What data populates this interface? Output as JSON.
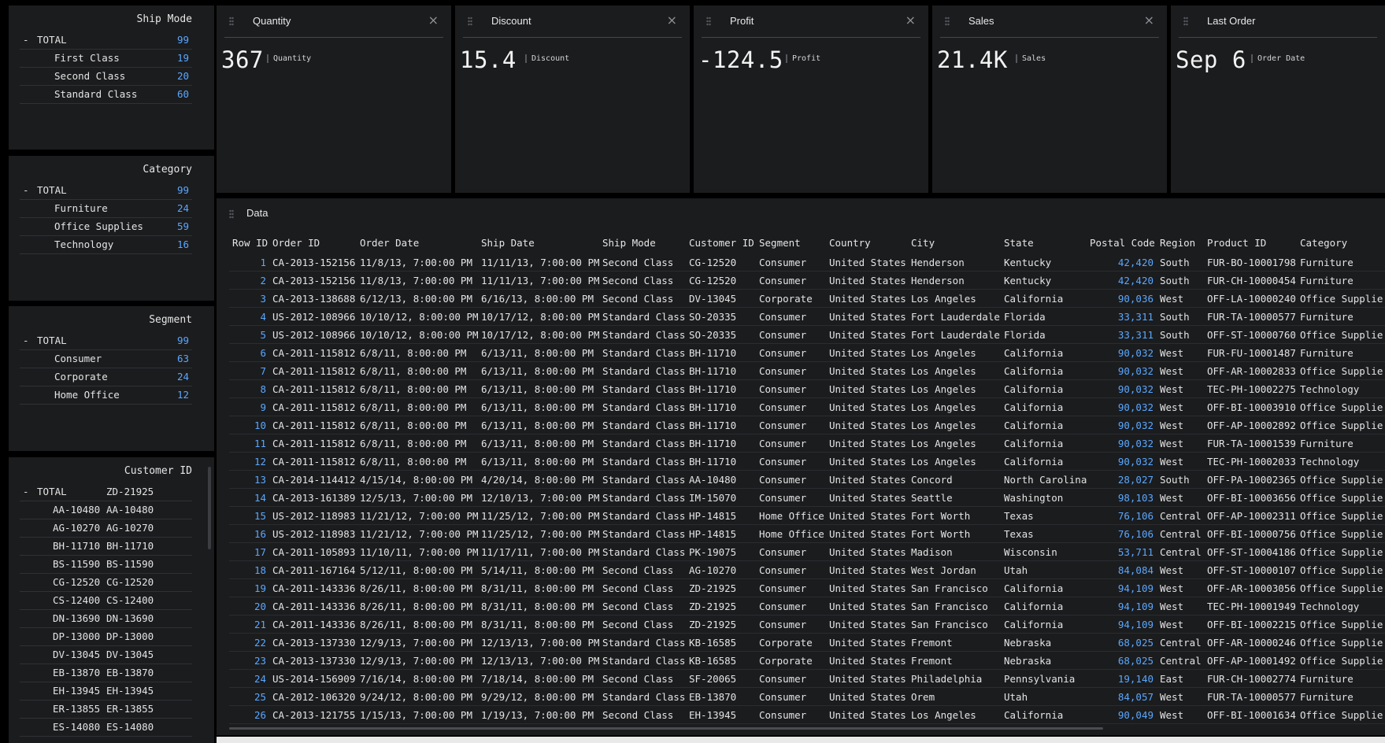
{
  "filters": {
    "ship_mode": {
      "title": "Ship Mode",
      "total": {
        "label": "TOTAL",
        "count": "99"
      },
      "items": [
        {
          "label": "First Class",
          "count": "19"
        },
        {
          "label": "Second Class",
          "count": "20"
        },
        {
          "label": "Standard Class",
          "count": "60"
        }
      ]
    },
    "category": {
      "title": "Category",
      "total": {
        "label": "TOTAL",
        "count": "99"
      },
      "items": [
        {
          "label": "Furniture",
          "count": "24"
        },
        {
          "label": "Office Supplies",
          "count": "59"
        },
        {
          "label": "Technology",
          "count": "16"
        }
      ]
    },
    "segment": {
      "title": "Segment",
      "total": {
        "label": "TOTAL",
        "count": "99"
      },
      "items": [
        {
          "label": "Consumer",
          "count": "63"
        },
        {
          "label": "Corporate",
          "count": "24"
        },
        {
          "label": "Home Office",
          "count": "12"
        }
      ]
    },
    "customer_id": {
      "title": "Customer ID",
      "total": {
        "label": "TOTAL",
        "value": "ZD-21925"
      },
      "items": [
        {
          "label": "AA-10480",
          "value": "AA-10480"
        },
        {
          "label": "AG-10270",
          "value": "AG-10270"
        },
        {
          "label": "BH-11710",
          "value": "BH-11710"
        },
        {
          "label": "BS-11590",
          "value": "BS-11590"
        },
        {
          "label": "CG-12520",
          "value": "CG-12520"
        },
        {
          "label": "CS-12400",
          "value": "CS-12400"
        },
        {
          "label": "DN-13690",
          "value": "DN-13690"
        },
        {
          "label": "DP-13000",
          "value": "DP-13000"
        },
        {
          "label": "DV-13045",
          "value": "DV-13045"
        },
        {
          "label": "EB-13870",
          "value": "EB-13870"
        },
        {
          "label": "EH-13945",
          "value": "EH-13945"
        },
        {
          "label": "ER-13855",
          "value": "ER-13855"
        },
        {
          "label": "ES-14080",
          "value": "ES-14080"
        }
      ]
    },
    "toggle_symbol": "-"
  },
  "kpis": [
    {
      "title": "Quantity",
      "value": "367",
      "unit": "Quantity"
    },
    {
      "title": "Discount",
      "value": "15.4",
      "unit": "Discount"
    },
    {
      "title": "Profit",
      "value": "-124.5",
      "unit": "Profit"
    },
    {
      "title": "Sales",
      "value": "21.4K",
      "unit": "Sales"
    },
    {
      "title": "Last Order",
      "value": "Sep 6",
      "unit": "Order Date"
    }
  ],
  "close_symbol": "×",
  "data_panel": {
    "title": "Data",
    "columns": [
      "Row ID",
      "Order ID",
      "Order Date",
      "Ship Date",
      "Ship Mode",
      "Customer ID",
      "Segment",
      "Country",
      "City",
      "State",
      "Postal Code",
      "Region",
      "Product ID",
      "Category"
    ],
    "rows": [
      [
        "1",
        "CA-2013-152156",
        "11/8/13, 7:00:00 PM",
        "11/11/13, 7:00:00 PM",
        "Second Class",
        "CG-12520",
        "Consumer",
        "United States",
        "Henderson",
        "Kentucky",
        "42,420",
        "South",
        "FUR-BO-10001798",
        "Furniture"
      ],
      [
        "2",
        "CA-2013-152156",
        "11/8/13, 7:00:00 PM",
        "11/11/13, 7:00:00 PM",
        "Second Class",
        "CG-12520",
        "Consumer",
        "United States",
        "Henderson",
        "Kentucky",
        "42,420",
        "South",
        "FUR-CH-10000454",
        "Furniture"
      ],
      [
        "3",
        "CA-2013-138688",
        "6/12/13, 8:00:00 PM",
        "6/16/13, 8:00:00 PM",
        "Second Class",
        "DV-13045",
        "Corporate",
        "United States",
        "Los Angeles",
        "California",
        "90,036",
        "West",
        "OFF-LA-10000240",
        "Office Supplie"
      ],
      [
        "4",
        "US-2012-108966",
        "10/10/12, 8:00:00 PM",
        "10/17/12, 8:00:00 PM",
        "Standard Class",
        "SO-20335",
        "Consumer",
        "United States",
        "Fort Lauderdale",
        "Florida",
        "33,311",
        "South",
        "FUR-TA-10000577",
        "Furniture"
      ],
      [
        "5",
        "US-2012-108966",
        "10/10/12, 8:00:00 PM",
        "10/17/12, 8:00:00 PM",
        "Standard Class",
        "SO-20335",
        "Consumer",
        "United States",
        "Fort Lauderdale",
        "Florida",
        "33,311",
        "South",
        "OFF-ST-10000760",
        "Office Supplie"
      ],
      [
        "6",
        "CA-2011-115812",
        "6/8/11, 8:00:00 PM",
        "6/13/11, 8:00:00 PM",
        "Standard Class",
        "BH-11710",
        "Consumer",
        "United States",
        "Los Angeles",
        "California",
        "90,032",
        "West",
        "FUR-FU-10001487",
        "Furniture"
      ],
      [
        "7",
        "CA-2011-115812",
        "6/8/11, 8:00:00 PM",
        "6/13/11, 8:00:00 PM",
        "Standard Class",
        "BH-11710",
        "Consumer",
        "United States",
        "Los Angeles",
        "California",
        "90,032",
        "West",
        "OFF-AR-10002833",
        "Office Supplie"
      ],
      [
        "8",
        "CA-2011-115812",
        "6/8/11, 8:00:00 PM",
        "6/13/11, 8:00:00 PM",
        "Standard Class",
        "BH-11710",
        "Consumer",
        "United States",
        "Los Angeles",
        "California",
        "90,032",
        "West",
        "TEC-PH-10002275",
        "Technology"
      ],
      [
        "9",
        "CA-2011-115812",
        "6/8/11, 8:00:00 PM",
        "6/13/11, 8:00:00 PM",
        "Standard Class",
        "BH-11710",
        "Consumer",
        "United States",
        "Los Angeles",
        "California",
        "90,032",
        "West",
        "OFF-BI-10003910",
        "Office Supplie"
      ],
      [
        "10",
        "CA-2011-115812",
        "6/8/11, 8:00:00 PM",
        "6/13/11, 8:00:00 PM",
        "Standard Class",
        "BH-11710",
        "Consumer",
        "United States",
        "Los Angeles",
        "California",
        "90,032",
        "West",
        "OFF-AP-10002892",
        "Office Supplie"
      ],
      [
        "11",
        "CA-2011-115812",
        "6/8/11, 8:00:00 PM",
        "6/13/11, 8:00:00 PM",
        "Standard Class",
        "BH-11710",
        "Consumer",
        "United States",
        "Los Angeles",
        "California",
        "90,032",
        "West",
        "FUR-TA-10001539",
        "Furniture"
      ],
      [
        "12",
        "CA-2011-115812",
        "6/8/11, 8:00:00 PM",
        "6/13/11, 8:00:00 PM",
        "Standard Class",
        "BH-11710",
        "Consumer",
        "United States",
        "Los Angeles",
        "California",
        "90,032",
        "West",
        "TEC-PH-10002033",
        "Technology"
      ],
      [
        "13",
        "CA-2014-114412",
        "4/15/14, 8:00:00 PM",
        "4/20/14, 8:00:00 PM",
        "Standard Class",
        "AA-10480",
        "Consumer",
        "United States",
        "Concord",
        "North Carolina",
        "28,027",
        "South",
        "OFF-PA-10002365",
        "Office Supplie"
      ],
      [
        "14",
        "CA-2013-161389",
        "12/5/13, 7:00:00 PM",
        "12/10/13, 7:00:00 PM",
        "Standard Class",
        "IM-15070",
        "Consumer",
        "United States",
        "Seattle",
        "Washington",
        "98,103",
        "West",
        "OFF-BI-10003656",
        "Office Supplie"
      ],
      [
        "15",
        "US-2012-118983",
        "11/21/12, 7:00:00 PM",
        "11/25/12, 7:00:00 PM",
        "Standard Class",
        "HP-14815",
        "Home Office",
        "United States",
        "Fort Worth",
        "Texas",
        "76,106",
        "Central",
        "OFF-AP-10002311",
        "Office Supplie"
      ],
      [
        "16",
        "US-2012-118983",
        "11/21/12, 7:00:00 PM",
        "11/25/12, 7:00:00 PM",
        "Standard Class",
        "HP-14815",
        "Home Office",
        "United States",
        "Fort Worth",
        "Texas",
        "76,106",
        "Central",
        "OFF-BI-10000756",
        "Office Supplie"
      ],
      [
        "17",
        "CA-2011-105893",
        "11/10/11, 7:00:00 PM",
        "11/17/11, 7:00:00 PM",
        "Standard Class",
        "PK-19075",
        "Consumer",
        "United States",
        "Madison",
        "Wisconsin",
        "53,711",
        "Central",
        "OFF-ST-10004186",
        "Office Supplie"
      ],
      [
        "18",
        "CA-2011-167164",
        "5/12/11, 8:00:00 PM",
        "5/14/11, 8:00:00 PM",
        "Second Class",
        "AG-10270",
        "Consumer",
        "United States",
        "West Jordan",
        "Utah",
        "84,084",
        "West",
        "OFF-ST-10000107",
        "Office Supplie"
      ],
      [
        "19",
        "CA-2011-143336",
        "8/26/11, 8:00:00 PM",
        "8/31/11, 8:00:00 PM",
        "Second Class",
        "ZD-21925",
        "Consumer",
        "United States",
        "San Francisco",
        "California",
        "94,109",
        "West",
        "OFF-AR-10003056",
        "Office Supplie"
      ],
      [
        "20",
        "CA-2011-143336",
        "8/26/11, 8:00:00 PM",
        "8/31/11, 8:00:00 PM",
        "Second Class",
        "ZD-21925",
        "Consumer",
        "United States",
        "San Francisco",
        "California",
        "94,109",
        "West",
        "TEC-PH-10001949",
        "Technology"
      ],
      [
        "21",
        "CA-2011-143336",
        "8/26/11, 8:00:00 PM",
        "8/31/11, 8:00:00 PM",
        "Second Class",
        "ZD-21925",
        "Consumer",
        "United States",
        "San Francisco",
        "California",
        "94,109",
        "West",
        "OFF-BI-10002215",
        "Office Supplie"
      ],
      [
        "22",
        "CA-2013-137330",
        "12/9/13, 7:00:00 PM",
        "12/13/13, 7:00:00 PM",
        "Standard Class",
        "KB-16585",
        "Corporate",
        "United States",
        "Fremont",
        "Nebraska",
        "68,025",
        "Central",
        "OFF-AR-10000246",
        "Office Supplie"
      ],
      [
        "23",
        "CA-2013-137330",
        "12/9/13, 7:00:00 PM",
        "12/13/13, 7:00:00 PM",
        "Standard Class",
        "KB-16585",
        "Corporate",
        "United States",
        "Fremont",
        "Nebraska",
        "68,025",
        "Central",
        "OFF-AP-10001492",
        "Office Supplie"
      ],
      [
        "24",
        "US-2014-156909",
        "7/16/14, 8:00:00 PM",
        "7/18/14, 8:00:00 PM",
        "Second Class",
        "SF-20065",
        "Consumer",
        "United States",
        "Philadelphia",
        "Pennsylvania",
        "19,140",
        "East",
        "FUR-CH-10002774",
        "Furniture"
      ],
      [
        "25",
        "CA-2012-106320",
        "9/24/12, 8:00:00 PM",
        "9/29/12, 8:00:00 PM",
        "Standard Class",
        "EB-13870",
        "Consumer",
        "United States",
        "Orem",
        "Utah",
        "84,057",
        "West",
        "FUR-TA-10000577",
        "Furniture"
      ],
      [
        "26",
        "CA-2013-121755",
        "1/15/13, 7:00:00 PM",
        "1/19/13, 7:00:00 PM",
        "Second Class",
        "EH-13945",
        "Consumer",
        "United States",
        "Los Angeles",
        "California",
        "90,049",
        "West",
        "OFF-BI-10001634",
        "Office Supplie"
      ]
    ]
  }
}
